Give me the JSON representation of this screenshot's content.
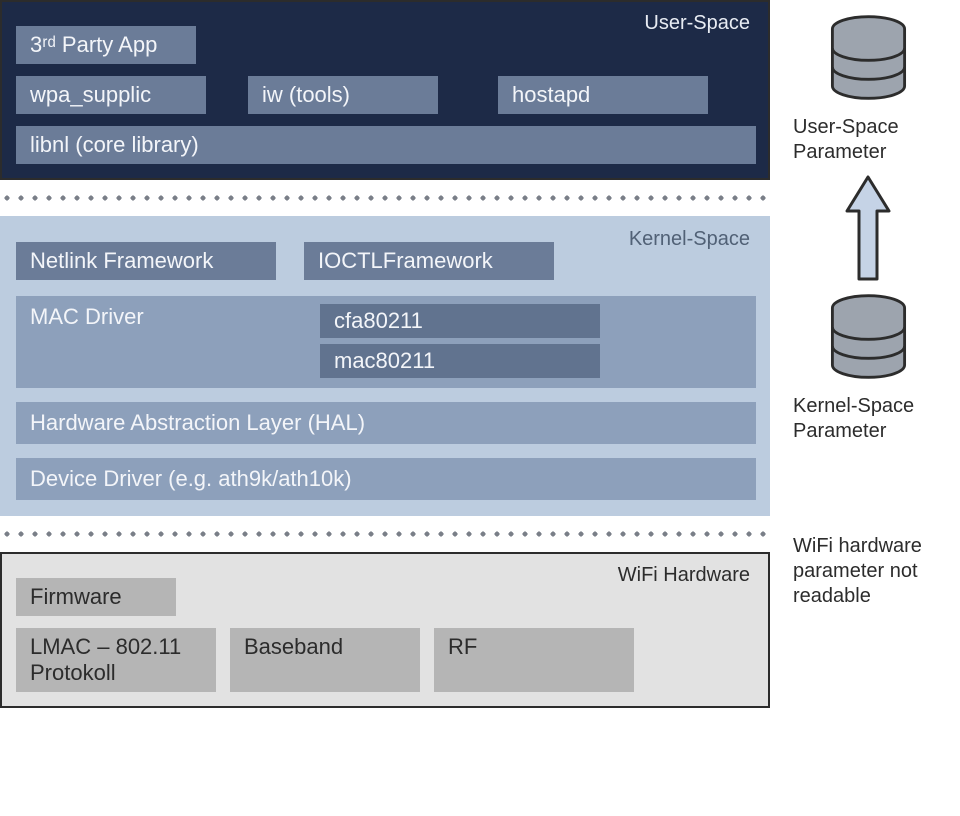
{
  "userspace": {
    "title": "User-Space",
    "thirdParty": "3ʳᵈ Party App",
    "wpa": "wpa_supplic",
    "iw": "iw (tools)",
    "hostapd": "hostapd",
    "libnl": "libnl (core library)"
  },
  "kernelspace": {
    "title": "Kernel-Space",
    "netlink": "Netlink Framework",
    "ioctl": "IOCTLFramework",
    "macdriver": "MAC Driver",
    "cfa": "cfa80211",
    "mac": "mac80211",
    "hal": "Hardware Abstraction Layer (HAL)",
    "devdrv": "Device Driver (e.g. ath9k/ath10k)"
  },
  "hardware": {
    "title": "WiFi Hardware",
    "firmware": "Firmware",
    "lmac": "LMAC – 802.11 Protokoll",
    "baseband": "Baseband",
    "rf": "RF"
  },
  "right": {
    "userParam": "User-Space Parameter",
    "kernelParam": "Kernel-Space Parameter",
    "hwNote": "WiFi hardware parameter not readable"
  }
}
